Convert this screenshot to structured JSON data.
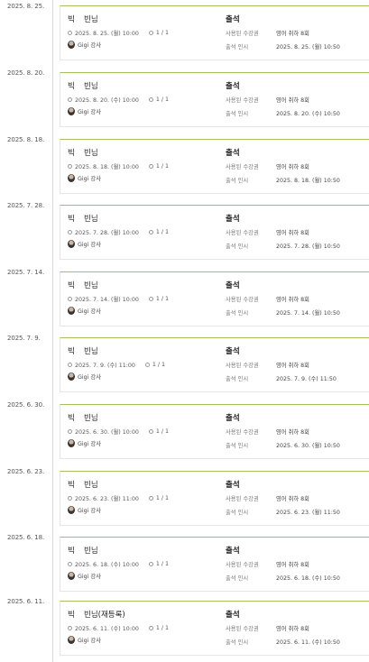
{
  "accent_color": "#9fc35a",
  "entries": [
    {
      "date": "2025. 8. 25.",
      "surname": "빅",
      "name": "빈님",
      "lesson_time": "2025. 8. 25. (월) 10:00",
      "count": "1 / 1",
      "teacher": "Gigi 강사",
      "status": "출석",
      "used_ticket_label": "사용된 수강권",
      "used_ticket": "영어 취하 8회",
      "attendance_label": "출석 인시",
      "attendance_time": "2025. 8. 25. (월) 10:50"
    },
    {
      "date": "2025. 8. 20.",
      "surname": "빅",
      "name": "빈님",
      "lesson_time": "2025. 8. 20. (수) 10:00",
      "count": "1 / 1",
      "teacher": "Gigi 강사",
      "status": "출석",
      "used_ticket_label": "사용된 수강권",
      "used_ticket": "영어 취하 8회",
      "attendance_label": "출석 인시",
      "attendance_time": "2025. 8. 20. (수) 10:50"
    },
    {
      "date": "2025. 8. 18.",
      "surname": "빅",
      "name": "빈님",
      "lesson_time": "2025. 8. 18. (월) 10:00",
      "count": "1 / 1",
      "teacher": "Gigi 강사",
      "status": "출석",
      "used_ticket_label": "사용된 수강권",
      "used_ticket": "영어 취하 8회",
      "attendance_label": "출석 인시",
      "attendance_time": "2025. 8. 18. (월) 10:50"
    },
    {
      "date": "2025. 7. 28.",
      "surname": "빅",
      "name": "빈님",
      "lesson_time": "2025. 7. 28. (월) 10:00",
      "count": "1 / 1",
      "teacher": "Gigi 강사",
      "status": "출석",
      "used_ticket_label": "사용된 수강권",
      "used_ticket": "영어 취하 8회",
      "attendance_label": "출석 인시",
      "attendance_time": "2025. 7. 28. (월) 10:50"
    },
    {
      "date": "2025. 7. 14.",
      "surname": "빅",
      "name": "빈님",
      "lesson_time": "2025. 7. 14. (월) 10:00",
      "count": "1 / 1",
      "teacher": "Gigi 강사",
      "status": "출석",
      "used_ticket_label": "사용된 수강권",
      "used_ticket": "영어 취하 8회",
      "attendance_label": "출석 인시",
      "attendance_time": "2025. 7. 14. (월) 10:50"
    },
    {
      "date": "2025. 7. 9.",
      "surname": "빅",
      "name": "빈님",
      "lesson_time": "2025. 7. 9. (수) 11:00",
      "count": "1 / 1",
      "teacher": "Gigi 강사",
      "status": "출석",
      "used_ticket_label": "사용된 수강권",
      "used_ticket": "영어 취하 8회",
      "attendance_label": "출석 인시",
      "attendance_time": "2025. 7. 9. (수) 11:50"
    },
    {
      "date": "2025. 6. 30.",
      "surname": "빅",
      "name": "빈님",
      "lesson_time": "2025. 6. 30. (월) 10:00",
      "count": "1 / 1",
      "teacher": "Gigi 강사",
      "status": "출석",
      "used_ticket_label": "사용된 수강권",
      "used_ticket": "영어 취하 8회",
      "attendance_label": "출석 인시",
      "attendance_time": "2025. 6. 30. (월) 10:50"
    },
    {
      "date": "2025. 6. 23.",
      "surname": "빅",
      "name": "빈님",
      "lesson_time": "2025. 6. 23. (월) 11:00",
      "count": "1 / 1",
      "teacher": "Gigi 강사",
      "status": "출석",
      "used_ticket_label": "사용된 수강권",
      "used_ticket": "영어 취하 8회",
      "attendance_label": "출석 인시",
      "attendance_time": "2025. 6. 23. (월) 11:50"
    },
    {
      "date": "2025. 6. 18.",
      "surname": "빅",
      "name": "빈님",
      "lesson_time": "2025. 6. 18. (수) 10:00",
      "count": "1 / 1",
      "teacher": "Gigi 강사",
      "status": "출석",
      "used_ticket_label": "사용된 수강권",
      "used_ticket": "영어 취하 8회",
      "attendance_label": "출석 인시",
      "attendance_time": "2025. 6. 18. (수) 10:50"
    },
    {
      "date": "2025. 6. 11.",
      "surname": "빅",
      "name": "빈님(재등록)",
      "lesson_time": "2025. 6. 11. (수) 10:00",
      "count": "1 / 1",
      "teacher": "Gigi 강사",
      "status": "출석",
      "used_ticket_label": "사용된 수강권",
      "used_ticket": "영어 취하 8회",
      "attendance_label": "출석 인시",
      "attendance_time": "2025. 6. 11. (수) 10:50"
    }
  ]
}
